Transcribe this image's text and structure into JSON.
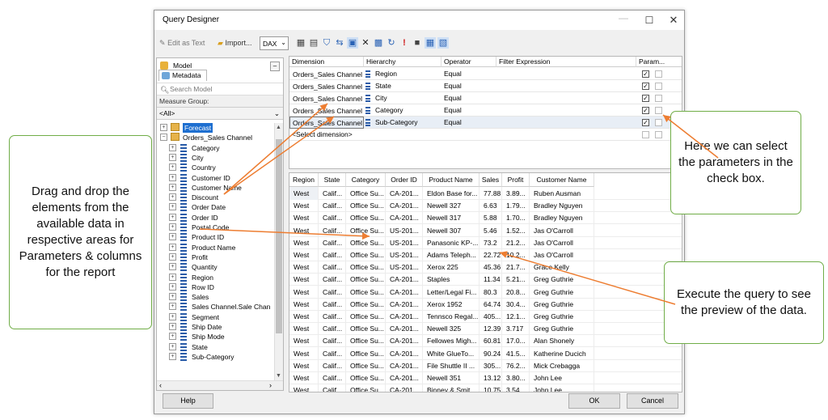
{
  "window": {
    "title": "Query Designer"
  },
  "toolbar": {
    "edit_as_text": "Edit as Text",
    "import": "Import...",
    "language": "DAX"
  },
  "metadata_panel": {
    "model_label": "Model",
    "tab_label": "Metadata",
    "search_placeholder": "Search Model",
    "measure_group_label": "Measure Group:",
    "measure_group_value": "<All>",
    "tree": [
      {
        "label": "Forecast",
        "type": "folder",
        "level": 0,
        "expanded": false,
        "selected": true
      },
      {
        "label": "Orders_Sales Channel",
        "type": "folder",
        "level": 0,
        "expanded": true,
        "selected": false
      },
      {
        "label": "Category",
        "type": "hierarchy",
        "level": 1
      },
      {
        "label": "City",
        "type": "hierarchy",
        "level": 1
      },
      {
        "label": "Country",
        "type": "hierarchy",
        "level": 1
      },
      {
        "label": "Customer ID",
        "type": "hierarchy",
        "level": 1
      },
      {
        "label": "Customer Name",
        "type": "hierarchy",
        "level": 1
      },
      {
        "label": "Discount",
        "type": "hierarchy",
        "level": 1
      },
      {
        "label": "Order Date",
        "type": "hierarchy",
        "level": 1
      },
      {
        "label": "Order ID",
        "type": "hierarchy",
        "level": 1
      },
      {
        "label": "Postal Code",
        "type": "hierarchy",
        "level": 1
      },
      {
        "label": "Product ID",
        "type": "hierarchy",
        "level": 1
      },
      {
        "label": "Product Name",
        "type": "hierarchy",
        "level": 1
      },
      {
        "label": "Profit",
        "type": "hierarchy",
        "level": 1
      },
      {
        "label": "Quantity",
        "type": "hierarchy",
        "level": 1
      },
      {
        "label": "Region",
        "type": "hierarchy",
        "level": 1
      },
      {
        "label": "Row ID",
        "type": "hierarchy",
        "level": 1
      },
      {
        "label": "Sales",
        "type": "hierarchy",
        "level": 1
      },
      {
        "label": "Sales Channel.Sale Chan",
        "type": "hierarchy",
        "level": 1
      },
      {
        "label": "Segment",
        "type": "hierarchy",
        "level": 1
      },
      {
        "label": "Ship Date",
        "type": "hierarchy",
        "level": 1
      },
      {
        "label": "Ship Mode",
        "type": "hierarchy",
        "level": 1
      },
      {
        "label": "State",
        "type": "hierarchy",
        "level": 1
      },
      {
        "label": "Sub-Category",
        "type": "hierarchy",
        "level": 1
      }
    ]
  },
  "filter_grid": {
    "headers": [
      "Dimension",
      "Hierarchy",
      "Operator",
      "Filter Expression",
      "Param..."
    ],
    "rows": [
      {
        "dimension": "Orders_Sales Channel",
        "hierarchy": "Region",
        "operator": "Equal",
        "expression": "",
        "param": true
      },
      {
        "dimension": "Orders_Sales Channel",
        "hierarchy": "State",
        "operator": "Equal",
        "expression": "",
        "param": true
      },
      {
        "dimension": "Orders_Sales Channel",
        "hierarchy": "City",
        "operator": "Equal",
        "expression": "",
        "param": true
      },
      {
        "dimension": "Orders_Sales Channel",
        "hierarchy": "Category",
        "operator": "Equal",
        "expression": "",
        "param": true
      },
      {
        "dimension": "Orders_Sales Channel",
        "hierarchy": "Sub-Category",
        "operator": "Equal",
        "expression": "",
        "param": true
      }
    ],
    "new_row_label": "<Select dimension>"
  },
  "results_grid": {
    "headers": [
      "Region",
      "State",
      "Category",
      "Order ID",
      "Product Name",
      "Sales",
      "Profit",
      "Customer Name"
    ],
    "rows": [
      [
        "West",
        "Calif...",
        "Office Su...",
        "CA-201...",
        "Eldon Base for...",
        "77.88",
        "3.89...",
        "Ruben Ausman"
      ],
      [
        "West",
        "Calif...",
        "Office Su...",
        "CA-201...",
        "Newell 327",
        "6.63",
        "1.79...",
        "Bradley Nguyen"
      ],
      [
        "West",
        "Calif...",
        "Office Su...",
        "CA-201...",
        "Newell 317",
        "5.88",
        "1.70...",
        "Bradley Nguyen"
      ],
      [
        "West",
        "Calif...",
        "Office Su...",
        "US-201...",
        "Newell 307",
        "5.46",
        "1.52...",
        "Jas O'Carroll"
      ],
      [
        "West",
        "Calif...",
        "Office Su...",
        "US-201...",
        "Panasonic KP-...",
        "73.2",
        "21.2...",
        "Jas O'Carroll"
      ],
      [
        "West",
        "Calif...",
        "Office Su...",
        "US-201...",
        "Adams Teleph...",
        "22.72",
        "10.2...",
        "Jas O'Carroll"
      ],
      [
        "West",
        "Calif...",
        "Office Su...",
        "US-201...",
        "Xerox 225",
        "45.36",
        "21.7...",
        "Grace Kelly"
      ],
      [
        "West",
        "Calif...",
        "Office Su...",
        "CA-201...",
        "Staples",
        "11.34",
        "5.21...",
        "Greg Guthrie"
      ],
      [
        "West",
        "Calif...",
        "Office Su...",
        "CA-201...",
        "Letter/Legal Fi...",
        "80.3",
        "20.8...",
        "Greg Guthrie"
      ],
      [
        "West",
        "Calif...",
        "Office Su...",
        "CA-201...",
        "Xerox 1952",
        "64.74",
        "30.4...",
        "Greg Guthrie"
      ],
      [
        "West",
        "Calif...",
        "Office Su...",
        "CA-201...",
        "Tennsco Regal...",
        "405....",
        "12.1...",
        "Greg Guthrie"
      ],
      [
        "West",
        "Calif...",
        "Office Su...",
        "CA-201...",
        "Newell 325",
        "12.39",
        "3.717",
        "Greg Guthrie"
      ],
      [
        "West",
        "Calif...",
        "Office Su...",
        "CA-201...",
        "Fellowes Migh...",
        "60.81",
        "17.0...",
        "Alan Shonely"
      ],
      [
        "West",
        "Calif...",
        "Office Su...",
        "CA-201...",
        "White GlueTo...",
        "90.24",
        "41.5...",
        "Katherine Ducich"
      ],
      [
        "West",
        "Calif...",
        "Office Su...",
        "CA-201...",
        "File Shuttle II ...",
        "305....",
        "76.2...",
        "Mick Crebagga"
      ],
      [
        "West",
        "Calif...",
        "Office Su...",
        "CA-201...",
        "Newell 351",
        "13.12",
        "3.80...",
        "John Lee"
      ],
      [
        "West",
        "Calif...",
        "Office Su...",
        "CA-201...",
        "Binney & Smit...",
        "10.75",
        "3.54...",
        "John Lee"
      ]
    ]
  },
  "buttons": {
    "help": "Help",
    "ok": "OK",
    "cancel": "Cancel"
  },
  "callouts": {
    "drag": "Drag and drop the elements from the available data in respective areas for Parameters & columns for the report",
    "params": "Here we can select the parameters in the check box.",
    "execute": "Execute the query to see the preview of the data."
  },
  "colors": {
    "callout_border": "#70ad47",
    "arrow": "#ed7d31",
    "selection": "#1e6fd0"
  }
}
